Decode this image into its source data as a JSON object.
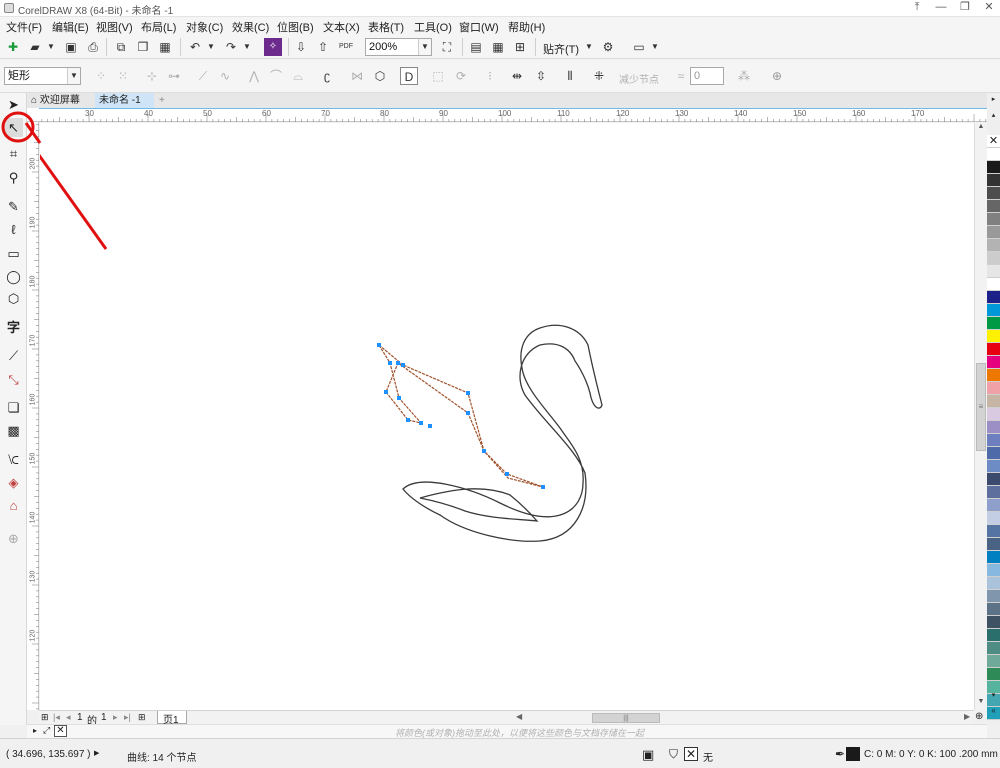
{
  "window": {
    "title": "CorelDRAW X8 (64-Bit) - 未命名 -1",
    "controls": [
      "⤒",
      "—",
      "❐",
      "✕"
    ]
  },
  "menu": [
    "文件(F)",
    "编辑(E)",
    "视图(V)",
    "布局(L)",
    "对象(C)",
    "效果(C)",
    "位图(B)",
    "文本(X)",
    "表格(T)",
    "工具(O)",
    "窗口(W)",
    "帮助(H)"
  ],
  "standard_toolbar": {
    "zoom_value": "200%",
    "snap_label": "贴齐(T)",
    "pdf_label": "PDF"
  },
  "property_bar": {
    "selection_mode": "矩形",
    "reduce_nodes_label": "减少节点",
    "smoothness_value": "0"
  },
  "doc_tabs": {
    "welcome": "欢迎屏幕",
    "active": "未命名 -1",
    "add": "+"
  },
  "ruler": {
    "h_labels": [
      "30",
      "40",
      "50",
      "60",
      "70",
      "80",
      "90",
      "100",
      "110",
      "120",
      "130",
      "140",
      "150",
      "160",
      "170"
    ],
    "v_labels": [
      "200",
      "190",
      "180",
      "170",
      "160",
      "150",
      "140",
      "130",
      "120"
    ]
  },
  "page_nav": {
    "current": "1",
    "of_label": "的",
    "total": "1",
    "page_tab": "页1"
  },
  "color_docker_hint": "将颜色(或对象)拖动至此处，以便将这些颜色与文档存储在一起",
  "status": {
    "coords": "( 34.696, 135.697 )",
    "object_info": "曲线: 14 个节点",
    "fill_label": "无",
    "outline_info": "C: 0 M: 0 Y: 0 K: 100  .200 mm"
  },
  "palette_colors": [
    "#ffffff",
    "#1a1a1a",
    "#333333",
    "#4d4d4d",
    "#666666",
    "#808080",
    "#999999",
    "#b3b3b3",
    "#cccccc",
    "#e6e6e6",
    "#ffffff",
    "#1d2088",
    "#0098d8",
    "#009944",
    "#fff100",
    "#e60012",
    "#e4007f",
    "#ee7700",
    "#f0a1a8",
    "#c6b5a5",
    "#d9c9e1",
    "#9b8fc6",
    "#6e7fbf",
    "#4f6aa8",
    "#6d8bc4",
    "#3c4a6e",
    "#5e6f9d",
    "#8e9fcb",
    "#c3cde4",
    "#5574a4",
    "#4a6283",
    "#0080c0",
    "#86b8e0",
    "#aac3db",
    "#7f96ac",
    "#5c7287",
    "#3f5264",
    "#2a6f6b",
    "#4f8d84",
    "#6fa99a",
    "#2e8b57",
    "#56b39d",
    "#44a6b0",
    "#1fa0b8"
  ],
  "swan_path_color": "#3a3a3a",
  "selected_path_color": "#a0522d",
  "node_color": "#1e90ff",
  "annotation_color": "#e01010"
}
